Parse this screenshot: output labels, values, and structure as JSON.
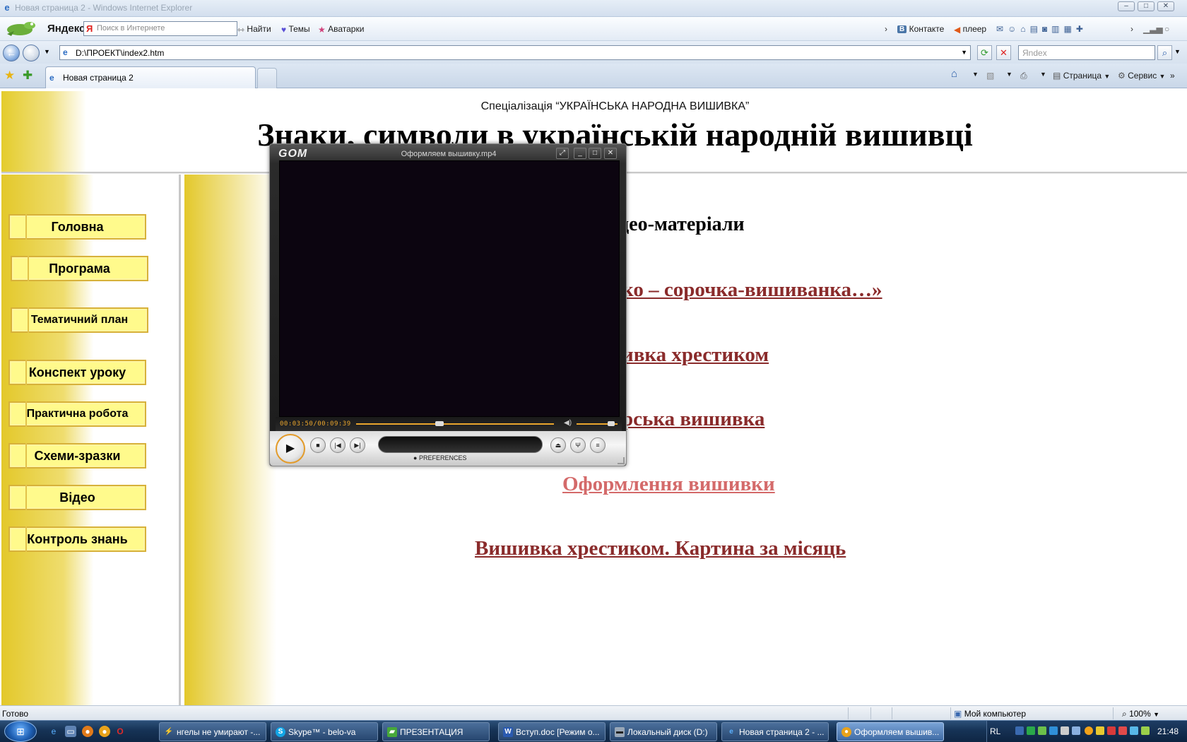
{
  "window": {
    "title": "Новая страница 2 - Windows Internet Explorer",
    "controls": [
      "–",
      "□",
      "✕"
    ]
  },
  "yandex_bar": {
    "logo": "Яндекс",
    "search_placeholder": "Поиск в Интернете",
    "find_label": "Найти",
    "themes_label": "Темы",
    "avatars_label": "Аватарки",
    "vk_label": "Контакте",
    "player_label": "плеер"
  },
  "address_bar": {
    "url": "D:\\ПРОЕКТ\\index2.htm",
    "search_placeholder": "Яndex"
  },
  "tabs": {
    "active_tab_label": "Новая страница 2"
  },
  "command_bar": {
    "page_label": "Страница",
    "tools_label": "Сервис"
  },
  "page": {
    "specialization": "Спеціалізація “УКРАЇНСЬКА НАРОДНА ВИШИВКА”",
    "title": "Знаки, символи в українській народній вишивці",
    "menu": [
      {
        "label": "Головна"
      },
      {
        "label": "Програма"
      },
      {
        "label": "Тематичний план"
      },
      {
        "label": "Конспект уроку"
      },
      {
        "label": "Практична робота"
      },
      {
        "label": "Схеми-зразки"
      },
      {
        "label": "Відео"
      },
      {
        "label": "Контроль знань"
      }
    ],
    "section_heading_visible": "део-матеріали",
    "links": [
      {
        "text": "ко – сорочка-вишиванка…»",
        "color": "#8a2b2b"
      },
      {
        "text": "ивка хрестиком",
        "color": "#8a2b2b"
      },
      {
        "text": "рська вишивка",
        "color": "#8a2b2b"
      },
      {
        "text": "Оформлення вишивки",
        "color": "#d46a6a"
      },
      {
        "text": "Вишивка хрестиком. Картина за місяць",
        "color": "#8a2b2b"
      }
    ],
    "accent_yellow": "#e3c82a",
    "button_fill": "#fffa8c"
  },
  "gom_player": {
    "logo": "GOM",
    "file_title": "Оформляем вышивку.mp4",
    "time": "00:03:50/00:09:39",
    "seek_progress": 0.4,
    "volume_level": 0.9,
    "preferences_label": "PREFERENCES",
    "accent": "#e9a52d"
  },
  "status_bar": {
    "status": "Готово",
    "zone": "Мой компьютер",
    "zoom": "100%"
  },
  "taskbar": {
    "tasks": [
      {
        "label": "нгелы не умирают -...",
        "icon": "lightning-icon"
      },
      {
        "label": "Skype™ - belo-va",
        "icon": "skype-icon"
      },
      {
        "label": "ПРЕЗЕНТАЦИЯ",
        "icon": "folder-icon"
      },
      {
        "label": "Вступ.doc [Режим о...",
        "icon": "word-icon"
      },
      {
        "label": "Локальный диск (D:)",
        "icon": "drive-icon"
      },
      {
        "label": "Новая страница 2 - ...",
        "icon": "ie-icon"
      },
      {
        "label": "Оформляем вышив...",
        "icon": "gom-icon"
      }
    ],
    "language": "RL",
    "clock": "21:48"
  }
}
